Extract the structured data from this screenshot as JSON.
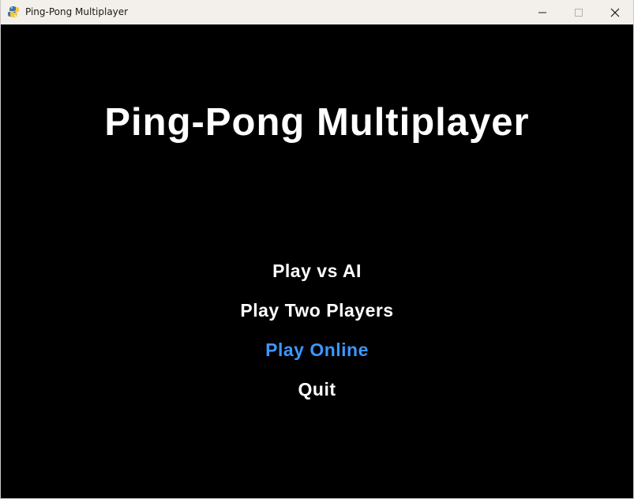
{
  "window": {
    "title": "Ping-Pong Multiplayer",
    "app_icon": "pygame-snake-icon",
    "controls": {
      "minimize_icon": "minimize-icon",
      "maximize_icon": "maximize-icon",
      "close_icon": "close-icon"
    }
  },
  "game": {
    "title": "Ping-Pong Multiplayer",
    "menu": {
      "items": [
        {
          "label": "Play vs AI",
          "selected": false
        },
        {
          "label": "Play Two Players",
          "selected": false
        },
        {
          "label": "Play Online",
          "selected": true
        },
        {
          "label": "Quit",
          "selected": false
        }
      ]
    }
  },
  "colors": {
    "background": "#000000",
    "text": "#ffffff",
    "selected": "#3d97ff",
    "titlebar": "#f3efea"
  }
}
